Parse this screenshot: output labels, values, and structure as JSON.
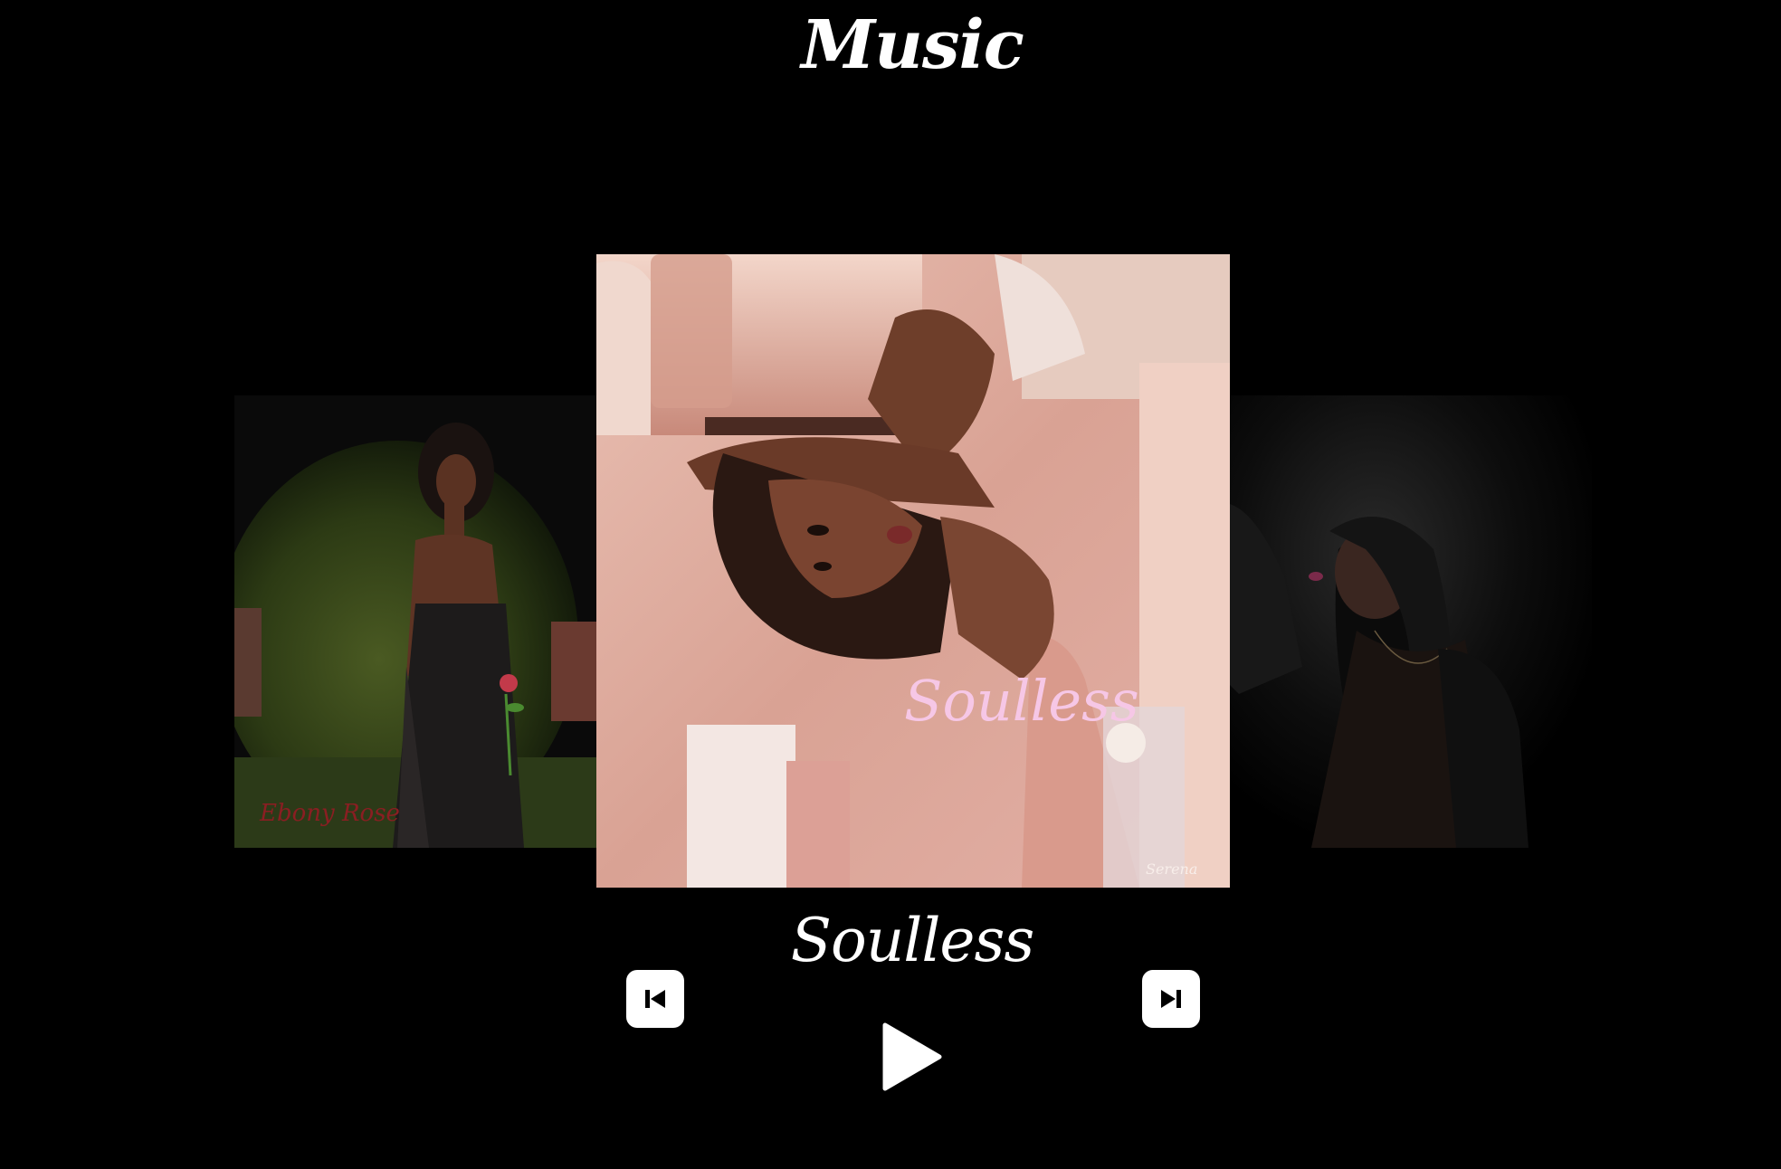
{
  "page": {
    "title": "Music"
  },
  "player": {
    "current_track": "Soulless"
  },
  "covers": {
    "prev": {
      "signature_text": "Ebony Rose"
    },
    "current": {
      "title_text": "Soulless",
      "signature_text": "Serena"
    },
    "next": {}
  },
  "controls": {
    "prev_icon": "skip-previous-icon",
    "next_icon": "skip-next-icon",
    "play_icon": "play-icon"
  },
  "colors": {
    "background": "#000000",
    "text": "#ffffff",
    "cover_title_pink": "#f6c7e6",
    "cover_pink": "#e8b4a8"
  }
}
